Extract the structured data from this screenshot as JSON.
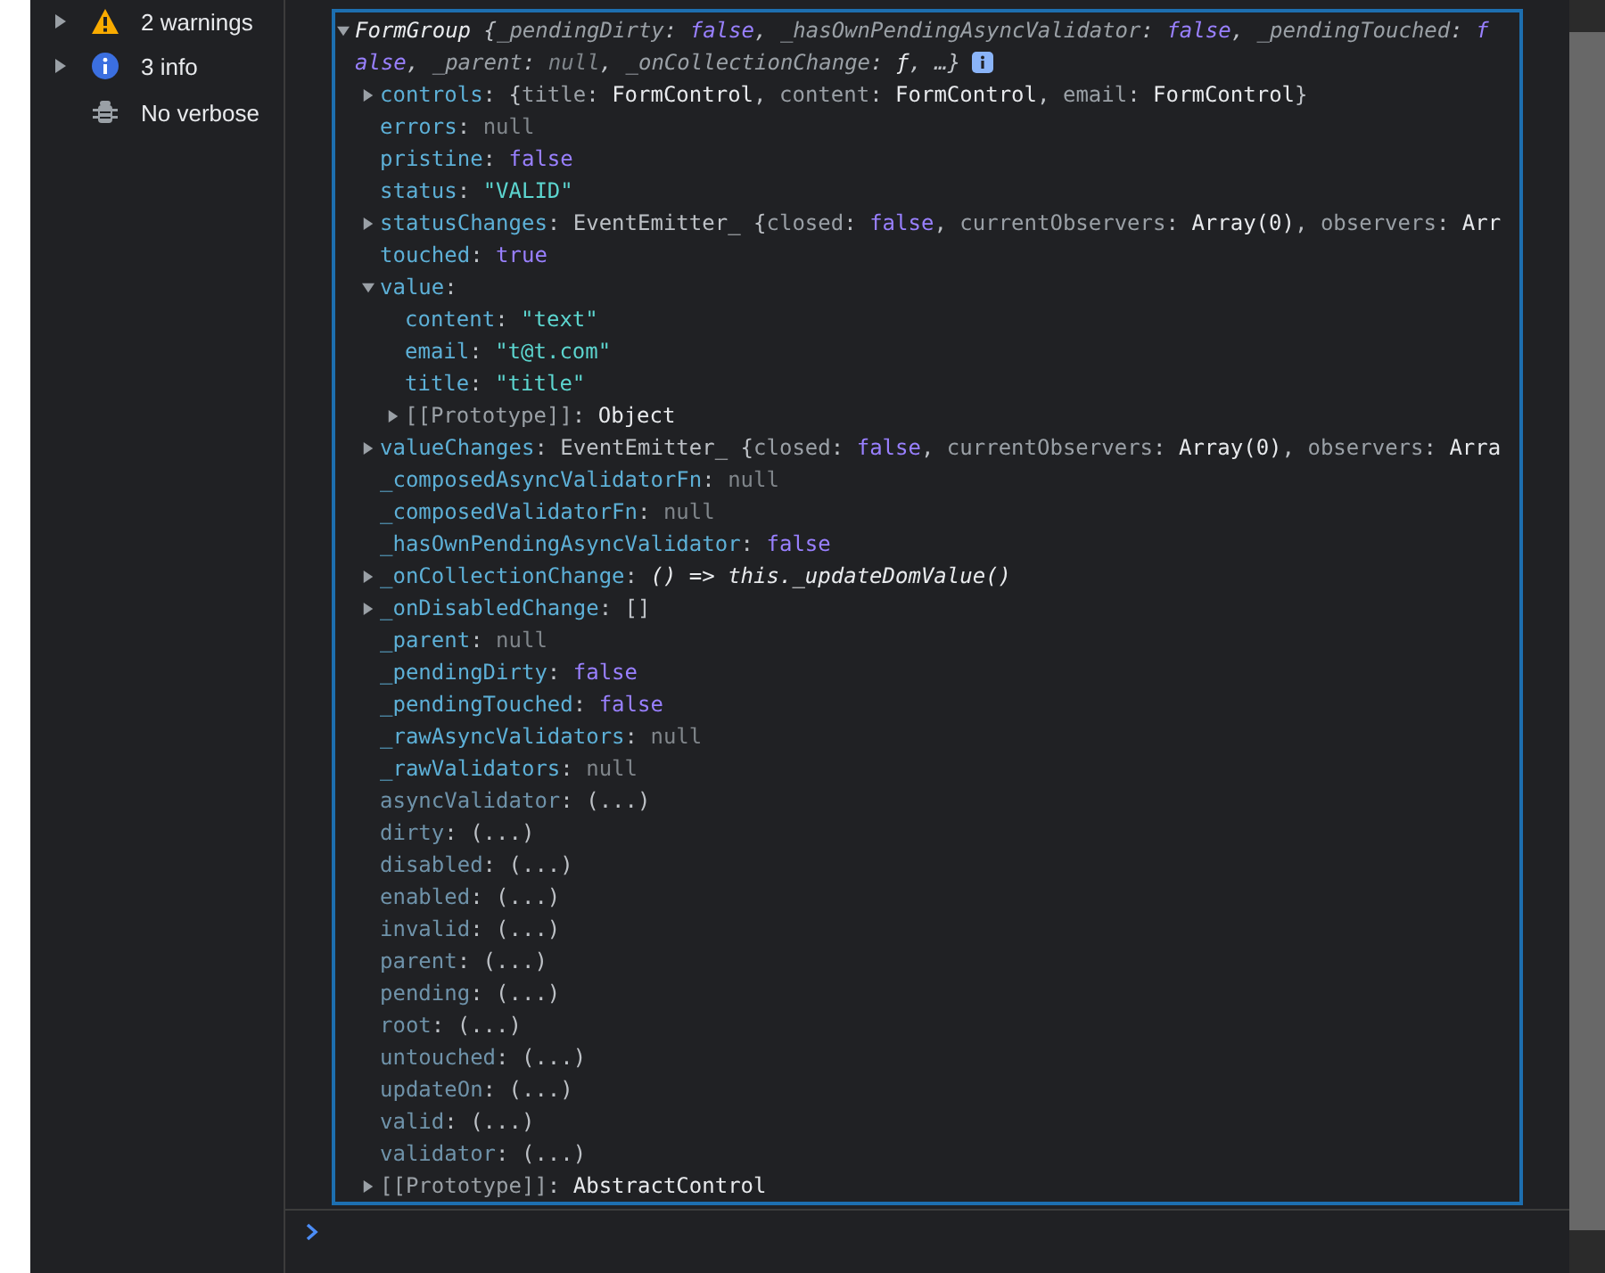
{
  "sidebar": {
    "items": [
      {
        "label": "2 warnings",
        "kind": "warning",
        "expanded": false
      },
      {
        "label": "3 info",
        "kind": "info",
        "expanded": false
      },
      {
        "label": "No verbose",
        "kind": "verbose"
      }
    ]
  },
  "console": {
    "object": {
      "expanded": true,
      "summary_lines": [
        [
          {
            "kind": "type",
            "text": "FormGroup"
          },
          {
            "kind": "punct",
            "text": " {"
          },
          {
            "kind": "pkey",
            "text": "_pendingDirty"
          },
          {
            "kind": "punct",
            "text": ": "
          },
          {
            "kind": "bool",
            "text": "false"
          },
          {
            "kind": "punct",
            "text": ", "
          },
          {
            "kind": "pkey",
            "text": "_hasOwnPendingAsyncValidator"
          },
          {
            "kind": "punct",
            "text": ": "
          },
          {
            "kind": "bool",
            "text": "false"
          },
          {
            "kind": "punct",
            "text": ", "
          },
          {
            "kind": "pkey",
            "text": "_pendingTouched"
          },
          {
            "kind": "punct",
            "text": ": "
          },
          {
            "kind": "bool",
            "text": "f"
          }
        ],
        [
          {
            "kind": "bool",
            "text": "alse"
          },
          {
            "kind": "punct",
            "text": ", "
          },
          {
            "kind": "pkey",
            "text": "_parent"
          },
          {
            "kind": "punct",
            "text": ": "
          },
          {
            "kind": "null",
            "text": "null"
          },
          {
            "kind": "punct",
            "text": ", "
          },
          {
            "kind": "pkey",
            "text": "_onCollectionChange"
          },
          {
            "kind": "punct",
            "text": ": "
          },
          {
            "kind": "type",
            "text": "ƒ"
          },
          {
            "kind": "punct",
            "text": ", …}"
          }
        ]
      ],
      "children": [
        {
          "expanded": false,
          "segments": [
            {
              "kind": "key",
              "text": "controls"
            },
            {
              "kind": "punct",
              "text": ": {"
            },
            {
              "kind": "pkey",
              "text": "title"
            },
            {
              "kind": "punct",
              "text": ": "
            },
            {
              "kind": "type",
              "text": "FormControl"
            },
            {
              "kind": "punct",
              "text": ", "
            },
            {
              "kind": "pkey",
              "text": "content"
            },
            {
              "kind": "punct",
              "text": ": "
            },
            {
              "kind": "type",
              "text": "FormControl"
            },
            {
              "kind": "punct",
              "text": ", "
            },
            {
              "kind": "pkey",
              "text": "email"
            },
            {
              "kind": "punct",
              "text": ": "
            },
            {
              "kind": "type",
              "text": "FormControl"
            },
            {
              "kind": "punct",
              "text": "}"
            }
          ]
        },
        {
          "segments": [
            {
              "kind": "key",
              "text": "errors"
            },
            {
              "kind": "punct",
              "text": ": "
            },
            {
              "kind": "null",
              "text": "null"
            }
          ]
        },
        {
          "segments": [
            {
              "kind": "key",
              "text": "pristine"
            },
            {
              "kind": "punct",
              "text": ": "
            },
            {
              "kind": "bool",
              "text": "false"
            }
          ]
        },
        {
          "segments": [
            {
              "kind": "key",
              "text": "status"
            },
            {
              "kind": "punct",
              "text": ": "
            },
            {
              "kind": "string",
              "text": "\"VALID\""
            }
          ]
        },
        {
          "expanded": false,
          "segments": [
            {
              "kind": "key",
              "text": "statusChanges"
            },
            {
              "kind": "punct",
              "text": ": "
            },
            {
              "kind": "muted",
              "text": "EventEmitter_"
            },
            {
              "kind": "punct",
              "text": " {"
            },
            {
              "kind": "pkey",
              "text": "closed"
            },
            {
              "kind": "punct",
              "text": ": "
            },
            {
              "kind": "bool",
              "text": "false"
            },
            {
              "kind": "punct",
              "text": ", "
            },
            {
              "kind": "pkey",
              "text": "currentObservers"
            },
            {
              "kind": "punct",
              "text": ": "
            },
            {
              "kind": "type",
              "text": "Array(0)"
            },
            {
              "kind": "punct",
              "text": ", "
            },
            {
              "kind": "pkey",
              "text": "observers"
            },
            {
              "kind": "punct",
              "text": ": "
            },
            {
              "kind": "type",
              "text": "Arr"
            }
          ]
        },
        {
          "segments": [
            {
              "kind": "key",
              "text": "touched"
            },
            {
              "kind": "punct",
              "text": ": "
            },
            {
              "kind": "bool",
              "text": "true"
            }
          ]
        },
        {
          "expanded": true,
          "segments": [
            {
              "kind": "key",
              "text": "value"
            },
            {
              "kind": "punct",
              "text": ":"
            }
          ],
          "children": [
            {
              "segments": [
                {
                  "kind": "key",
                  "text": "content"
                },
                {
                  "kind": "punct",
                  "text": ": "
                },
                {
                  "kind": "string",
                  "text": "\"text\""
                }
              ]
            },
            {
              "segments": [
                {
                  "kind": "key",
                  "text": "email"
                },
                {
                  "kind": "punct",
                  "text": ": "
                },
                {
                  "kind": "string",
                  "text": "\"t@t.com\""
                }
              ]
            },
            {
              "segments": [
                {
                  "kind": "key",
                  "text": "title"
                },
                {
                  "kind": "punct",
                  "text": ": "
                },
                {
                  "kind": "string",
                  "text": "\"title\""
                }
              ]
            },
            {
              "expanded": false,
              "segments": [
                {
                  "kind": "proto",
                  "text": "[[Prototype]]"
                },
                {
                  "kind": "punct",
                  "text": ": "
                },
                {
                  "kind": "type",
                  "text": "Object"
                }
              ]
            }
          ]
        },
        {
          "expanded": false,
          "segments": [
            {
              "kind": "key",
              "text": "valueChanges"
            },
            {
              "kind": "punct",
              "text": ": "
            },
            {
              "kind": "muted",
              "text": "EventEmitter_"
            },
            {
              "kind": "punct",
              "text": " {"
            },
            {
              "kind": "pkey",
              "text": "closed"
            },
            {
              "kind": "punct",
              "text": ": "
            },
            {
              "kind": "bool",
              "text": "false"
            },
            {
              "kind": "punct",
              "text": ", "
            },
            {
              "kind": "pkey",
              "text": "currentObservers"
            },
            {
              "kind": "punct",
              "text": ": "
            },
            {
              "kind": "type",
              "text": "Array(0)"
            },
            {
              "kind": "punct",
              "text": ", "
            },
            {
              "kind": "pkey",
              "text": "observers"
            },
            {
              "kind": "punct",
              "text": ": "
            },
            {
              "kind": "type",
              "text": "Arra"
            }
          ]
        },
        {
          "segments": [
            {
              "kind": "key",
              "text": "_composedAsyncValidatorFn"
            },
            {
              "kind": "punct",
              "text": ": "
            },
            {
              "kind": "null",
              "text": "null"
            }
          ]
        },
        {
          "segments": [
            {
              "kind": "key",
              "text": "_composedValidatorFn"
            },
            {
              "kind": "punct",
              "text": ": "
            },
            {
              "kind": "null",
              "text": "null"
            }
          ]
        },
        {
          "segments": [
            {
              "kind": "key",
              "text": "_hasOwnPendingAsyncValidator"
            },
            {
              "kind": "punct",
              "text": ": "
            },
            {
              "kind": "bool",
              "text": "false"
            }
          ]
        },
        {
          "expanded": false,
          "segments": [
            {
              "kind": "key",
              "text": "_onCollectionChange"
            },
            {
              "kind": "punct",
              "text": ": "
            },
            {
              "kind": "func",
              "text": "() => this._updateDomValue()"
            }
          ]
        },
        {
          "expanded": false,
          "segments": [
            {
              "kind": "key",
              "text": "_onDisabledChange"
            },
            {
              "kind": "punct",
              "text": ": []"
            }
          ]
        },
        {
          "segments": [
            {
              "kind": "key",
              "text": "_parent"
            },
            {
              "kind": "punct",
              "text": ": "
            },
            {
              "kind": "null",
              "text": "null"
            }
          ]
        },
        {
          "segments": [
            {
              "kind": "key",
              "text": "_pendingDirty"
            },
            {
              "kind": "punct",
              "text": ": "
            },
            {
              "kind": "bool",
              "text": "false"
            }
          ]
        },
        {
          "segments": [
            {
              "kind": "key",
              "text": "_pendingTouched"
            },
            {
              "kind": "punct",
              "text": ": "
            },
            {
              "kind": "bool",
              "text": "false"
            }
          ]
        },
        {
          "segments": [
            {
              "kind": "key",
              "text": "_rawAsyncValidators"
            },
            {
              "kind": "punct",
              "text": ": "
            },
            {
              "kind": "null",
              "text": "null"
            }
          ]
        },
        {
          "segments": [
            {
              "kind": "key",
              "text": "_rawValidators"
            },
            {
              "kind": "punct",
              "text": ": "
            },
            {
              "kind": "null",
              "text": "null"
            }
          ]
        },
        {
          "segments": [
            {
              "kind": "accessor",
              "text": "asyncValidator"
            },
            {
              "kind": "punct",
              "text": ": (...)"
            }
          ]
        },
        {
          "segments": [
            {
              "kind": "accessor",
              "text": "dirty"
            },
            {
              "kind": "punct",
              "text": ": (...)"
            }
          ]
        },
        {
          "segments": [
            {
              "kind": "accessor",
              "text": "disabled"
            },
            {
              "kind": "punct",
              "text": ": (...)"
            }
          ]
        },
        {
          "segments": [
            {
              "kind": "accessor",
              "text": "enabled"
            },
            {
              "kind": "punct",
              "text": ": (...)"
            }
          ]
        },
        {
          "segments": [
            {
              "kind": "accessor",
              "text": "invalid"
            },
            {
              "kind": "punct",
              "text": ": (...)"
            }
          ]
        },
        {
          "segments": [
            {
              "kind": "accessor",
              "text": "parent"
            },
            {
              "kind": "punct",
              "text": ": (...)"
            }
          ]
        },
        {
          "segments": [
            {
              "kind": "accessor",
              "text": "pending"
            },
            {
              "kind": "punct",
              "text": ": (...)"
            }
          ]
        },
        {
          "segments": [
            {
              "kind": "accessor",
              "text": "root"
            },
            {
              "kind": "punct",
              "text": ": (...)"
            }
          ]
        },
        {
          "segments": [
            {
              "kind": "accessor",
              "text": "untouched"
            },
            {
              "kind": "punct",
              "text": ": (...)"
            }
          ]
        },
        {
          "segments": [
            {
              "kind": "accessor",
              "text": "updateOn"
            },
            {
              "kind": "punct",
              "text": ": (...)"
            }
          ]
        },
        {
          "segments": [
            {
              "kind": "accessor",
              "text": "valid"
            },
            {
              "kind": "punct",
              "text": ": (...)"
            }
          ]
        },
        {
          "segments": [
            {
              "kind": "accessor",
              "text": "validator"
            },
            {
              "kind": "punct",
              "text": ": (...)"
            }
          ]
        },
        {
          "expanded": false,
          "segments": [
            {
              "kind": "proto",
              "text": "[[Prototype]]"
            },
            {
              "kind": "punct",
              "text": ": "
            },
            {
              "kind": "type",
              "text": "AbstractControl"
            }
          ]
        }
      ]
    }
  }
}
